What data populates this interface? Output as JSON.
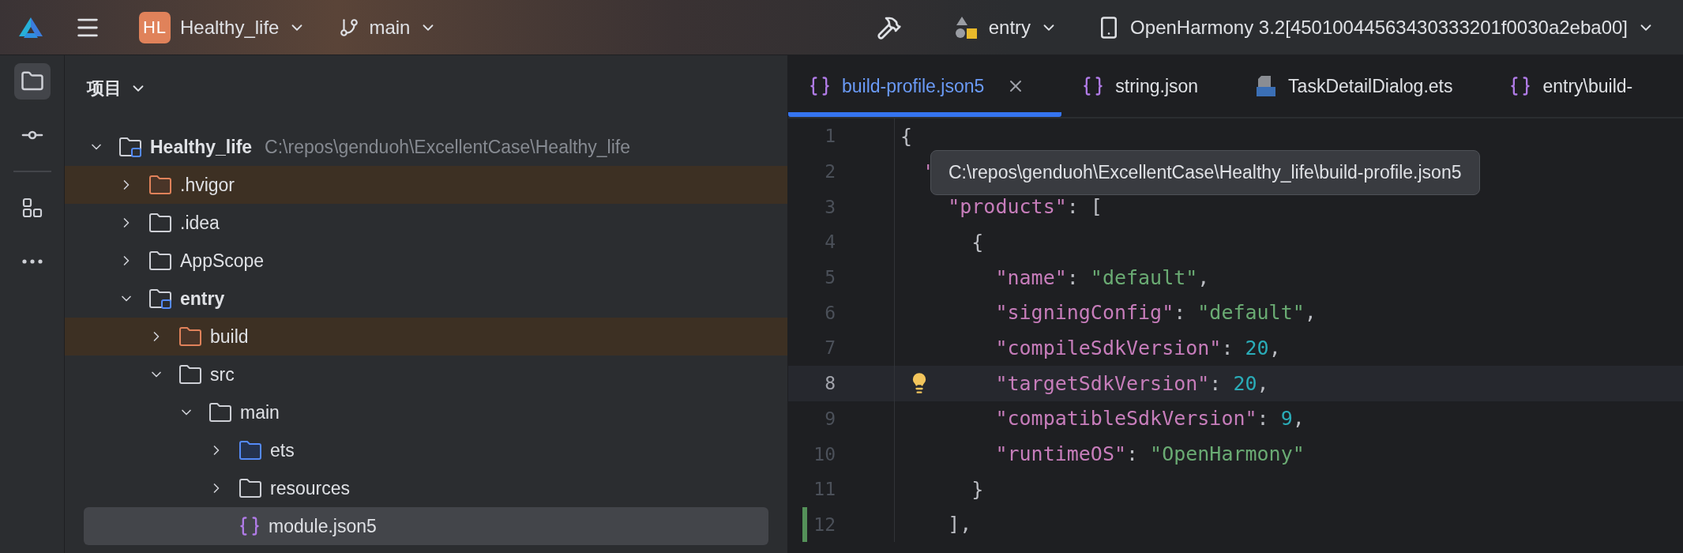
{
  "toolbar": {
    "project": {
      "initials": "HL",
      "name": "Healthy_life"
    },
    "branch": "main",
    "module": "entry",
    "device": "OpenHarmony 3.2[45010044563430333201f0030a2eba00]"
  },
  "rail": [
    {
      "kind": "project",
      "selected": true
    },
    {
      "kind": "commit",
      "selected": false
    },
    {
      "kind": "structure",
      "selected": false
    },
    {
      "kind": "more",
      "selected": false
    }
  ],
  "panel": {
    "title": "项目"
  },
  "tree": [
    {
      "label": "Healthy_life",
      "kind": "module",
      "expanded": true,
      "selected": false,
      "path": "C:\\repos\\genduoh\\ExcellentCase\\Healthy_life",
      "children": [
        {
          "label": ".hvigor",
          "kind": "excluded",
          "expanded": false,
          "selected": false
        },
        {
          "label": ".idea",
          "kind": "folder",
          "expanded": false,
          "selected": false
        },
        {
          "label": "AppScope",
          "kind": "folder",
          "expanded": false,
          "selected": false
        },
        {
          "label": "entry",
          "kind": "module",
          "expanded": true,
          "selected": false,
          "children": [
            {
              "label": "build",
              "kind": "excluded",
              "expanded": false,
              "selected": false
            },
            {
              "label": "src",
              "kind": "folder",
              "expanded": true,
              "selected": false,
              "children": [
                {
                  "label": "main",
                  "kind": "folder",
                  "expanded": true,
                  "selected": false,
                  "children": [
                    {
                      "label": "ets",
                      "kind": "source",
                      "expanded": false,
                      "selected": false
                    },
                    {
                      "label": "resources",
                      "kind": "folder",
                      "expanded": false,
                      "selected": false
                    },
                    {
                      "label": "module.json5",
                      "kind": "file",
                      "selected": true
                    }
                  ]
                }
              ]
            }
          ]
        }
      ]
    }
  ],
  "tabs": [
    {
      "label": "build-profile.json5",
      "kind": "json",
      "selected": true,
      "closable": true
    },
    {
      "label": "string.json",
      "kind": "json",
      "selected": false,
      "closable": false
    },
    {
      "label": "TaskDetailDialog.ets",
      "kind": "ets",
      "selected": false,
      "closable": false
    },
    {
      "label": "entry\\build-",
      "kind": "json",
      "selected": false,
      "closable": false
    }
  ],
  "tooltip": {
    "text": "C:\\repos\\genduoh\\ExcellentCase\\Healthy_life\\build-profile.json5"
  },
  "lines": [
    {
      "number": "1",
      "current": false,
      "changed": false,
      "hint": false,
      "tokens": [
        {
          "kind": "punct",
          "text": "{"
        }
      ]
    },
    {
      "number": "2",
      "current": false,
      "changed": false,
      "hint": false,
      "tokens": [
        {
          "kind": "key",
          "text": "  \""
        }
      ]
    },
    {
      "number": "3",
      "current": false,
      "changed": false,
      "hint": false,
      "tokens": [
        {
          "kind": "key",
          "text": "    \"products\""
        },
        {
          "kind": "punct",
          "text": ": ["
        }
      ]
    },
    {
      "number": "4",
      "current": false,
      "changed": false,
      "hint": false,
      "tokens": [
        {
          "kind": "punct",
          "text": "      {"
        }
      ]
    },
    {
      "number": "5",
      "current": false,
      "changed": false,
      "hint": false,
      "tokens": [
        {
          "kind": "key",
          "text": "        \"name\""
        },
        {
          "kind": "punct",
          "text": ": "
        },
        {
          "kind": "string",
          "text": "\"default\""
        },
        {
          "kind": "punct",
          "text": ","
        }
      ]
    },
    {
      "number": "6",
      "current": false,
      "changed": false,
      "hint": false,
      "tokens": [
        {
          "kind": "key",
          "text": "        \"signingConfig\""
        },
        {
          "kind": "punct",
          "text": ": "
        },
        {
          "kind": "string",
          "text": "\"default\""
        },
        {
          "kind": "punct",
          "text": ","
        }
      ]
    },
    {
      "number": "7",
      "current": false,
      "changed": false,
      "hint": false,
      "tokens": [
        {
          "kind": "key",
          "text": "        \"compileSdkVersion\""
        },
        {
          "kind": "punct",
          "text": ": "
        },
        {
          "kind": "number",
          "text": "20"
        },
        {
          "kind": "punct",
          "text": ","
        }
      ]
    },
    {
      "number": "8",
      "current": true,
      "changed": false,
      "hint": true,
      "tokens": [
        {
          "kind": "key",
          "text": "        \"targetSdkVersion\""
        },
        {
          "kind": "punct",
          "text": ": "
        },
        {
          "kind": "number",
          "text": "20"
        },
        {
          "kind": "punct",
          "text": ","
        }
      ]
    },
    {
      "number": "9",
      "current": false,
      "changed": false,
      "hint": false,
      "tokens": [
        {
          "kind": "key",
          "text": "        \"compatibleSdkVersion\""
        },
        {
          "kind": "punct",
          "text": ": "
        },
        {
          "kind": "number",
          "text": "9"
        },
        {
          "kind": "punct",
          "text": ","
        }
      ]
    },
    {
      "number": "10",
      "current": false,
      "changed": false,
      "hint": false,
      "tokens": [
        {
          "kind": "key",
          "text": "        \"runtimeOS\""
        },
        {
          "kind": "punct",
          "text": ": "
        },
        {
          "kind": "string",
          "text": "\"OpenHarmony\""
        }
      ]
    },
    {
      "number": "11",
      "current": false,
      "changed": false,
      "hint": false,
      "tokens": [
        {
          "kind": "punct",
          "text": "      }"
        }
      ]
    },
    {
      "number": "12",
      "current": false,
      "changed": true,
      "hint": false,
      "tokens": [
        {
          "kind": "punct",
          "text": "    ],"
        }
      ]
    }
  ]
}
